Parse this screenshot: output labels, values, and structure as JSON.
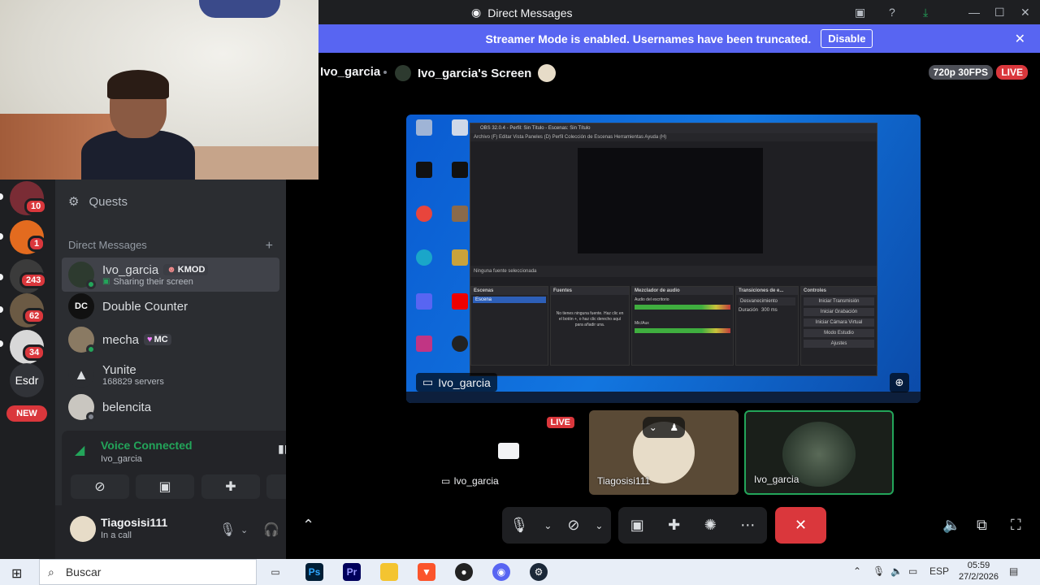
{
  "titlebar": {
    "title": "Direct Messages"
  },
  "banner": {
    "message": "Streamer Mode is enabled. Usernames have been truncated.",
    "button": "Disable"
  },
  "rail": {
    "badges": [
      "10",
      "1",
      "243",
      "62",
      "34"
    ],
    "text_server": "Esdr",
    "new_label": "NEW"
  },
  "sidebar": {
    "quests_label": "Quests",
    "dm_header": "Direct Messages",
    "dm_list": [
      {
        "name": "Ivo_garcia",
        "tag": "KMOD",
        "sub": "Sharing their screen"
      },
      {
        "name": "Double Counter",
        "sub": ""
      },
      {
        "name": "mecha",
        "tag": "MC",
        "sub": ""
      },
      {
        "name": "Yunite",
        "sub": "168829 servers"
      },
      {
        "name": "belencita",
        "sub": ""
      }
    ]
  },
  "voice": {
    "status": "Voice Connected",
    "channel": "Ivo_garcia"
  },
  "user": {
    "name": "Tiagosisi111",
    "status": "In a call"
  },
  "stream": {
    "streamer": "Ivo_garcia",
    "screen_title": "Ivo_garcia's Screen",
    "quality": "720p 30FPS",
    "live_label": "LIVE",
    "name_chip": "Ivo_garcia"
  },
  "obs": {
    "title": "OBS 32.0.4 - Perfil: Sin Título - Escenas: Sin Título",
    "menu": "Archivo (F)   Editar   Vista   Paneles (D)   Perfil   Colección de Escenas   Herramientas   Ayuda (H)",
    "no_source": "Ninguna fuente seleccionada",
    "docks": [
      "Escenas",
      "Fuentes",
      "Mezclador de audio",
      "Transiciones de e...",
      "Controles"
    ],
    "scene_item": "Escena",
    "sources_empty": "No tienes ninguna fuente. Haz clic en el botón +, o haz clic derecho aquí para añadir una.",
    "controls": [
      "Iniciar Transmisión",
      "Iniciar Grabación",
      "Iniciar Cámara Virtual",
      "Modo Estudio",
      "Ajustes"
    ],
    "transition": "Desvanecimiento",
    "duration_label": "Duración",
    "duration_value": "300 ms",
    "mixer_items": [
      "Audio del escritorio",
      "Mic/Aux"
    ]
  },
  "tiles": [
    {
      "name": "Ivo_garcia",
      "live": "LIVE"
    },
    {
      "name": "Tiagosisi111"
    },
    {
      "name": "Ivo_garcia"
    }
  ],
  "taskbar": {
    "search_placeholder": "Buscar",
    "lang": "ESP",
    "time": "05:59",
    "date": "27/2/2026"
  },
  "colors": {
    "blurple": "#5865f2",
    "green": "#23a55a",
    "red": "#da373c"
  }
}
